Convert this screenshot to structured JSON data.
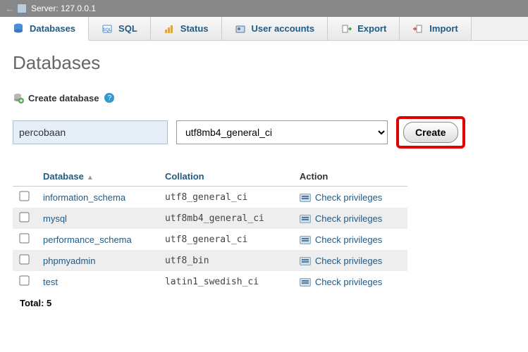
{
  "topbar": {
    "server_label": "Server: 127.0.0.1"
  },
  "tabs": {
    "databases": "Databases",
    "sql": "SQL",
    "status": "Status",
    "users": "User accounts",
    "export": "Export",
    "import": "Import"
  },
  "page_title": "Databases",
  "create": {
    "label": "Create database",
    "input_value": "percobaan",
    "collation_selected": "utf8mb4_general_ci",
    "button": "Create"
  },
  "table": {
    "headers": {
      "database": "Database",
      "collation": "Collation",
      "action": "Action"
    },
    "rows": [
      {
        "name": "information_schema",
        "collation": "utf8_general_ci",
        "action": "Check privileges"
      },
      {
        "name": "mysql",
        "collation": "utf8mb4_general_ci",
        "action": "Check privileges"
      },
      {
        "name": "performance_schema",
        "collation": "utf8_general_ci",
        "action": "Check privileges"
      },
      {
        "name": "phpmyadmin",
        "collation": "utf8_bin",
        "action": "Check privileges"
      },
      {
        "name": "test",
        "collation": "latin1_swedish_ci",
        "action": "Check privileges"
      }
    ],
    "total_label": "Total: 5"
  }
}
